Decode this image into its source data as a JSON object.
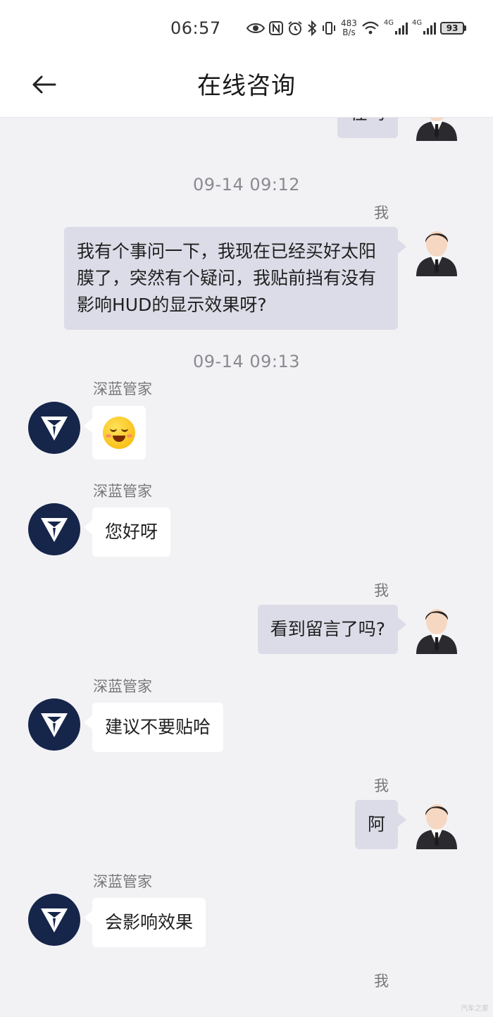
{
  "status_bar": {
    "time": "06:57",
    "speed_value": "483",
    "speed_unit": "B/s",
    "net1": "4G",
    "net2": "4G",
    "battery": "93"
  },
  "header": {
    "title": "在线咨询"
  },
  "chat": {
    "partial_top": "在吗",
    "timestamp_1": "09-14 09:12",
    "timestamp_2": "09-14 09:13",
    "me_label": "我",
    "bot_label": "深蓝管家",
    "messages": [
      {
        "from": "me",
        "text": "我有个事问一下，我现在已经买好太阳膜了，突然有个疑问，我贴前挡有没有影响HUD的显示效果呀?"
      },
      {
        "from": "bot",
        "text": "emoji"
      },
      {
        "from": "bot",
        "text": "您好呀"
      },
      {
        "from": "me",
        "text": "看到留言了吗?"
      },
      {
        "from": "bot",
        "text": "建议不要贴哈"
      },
      {
        "from": "me",
        "text": "阿"
      },
      {
        "from": "bot",
        "text": "会影响效果"
      }
    ]
  },
  "watermark": "汽车之家"
}
